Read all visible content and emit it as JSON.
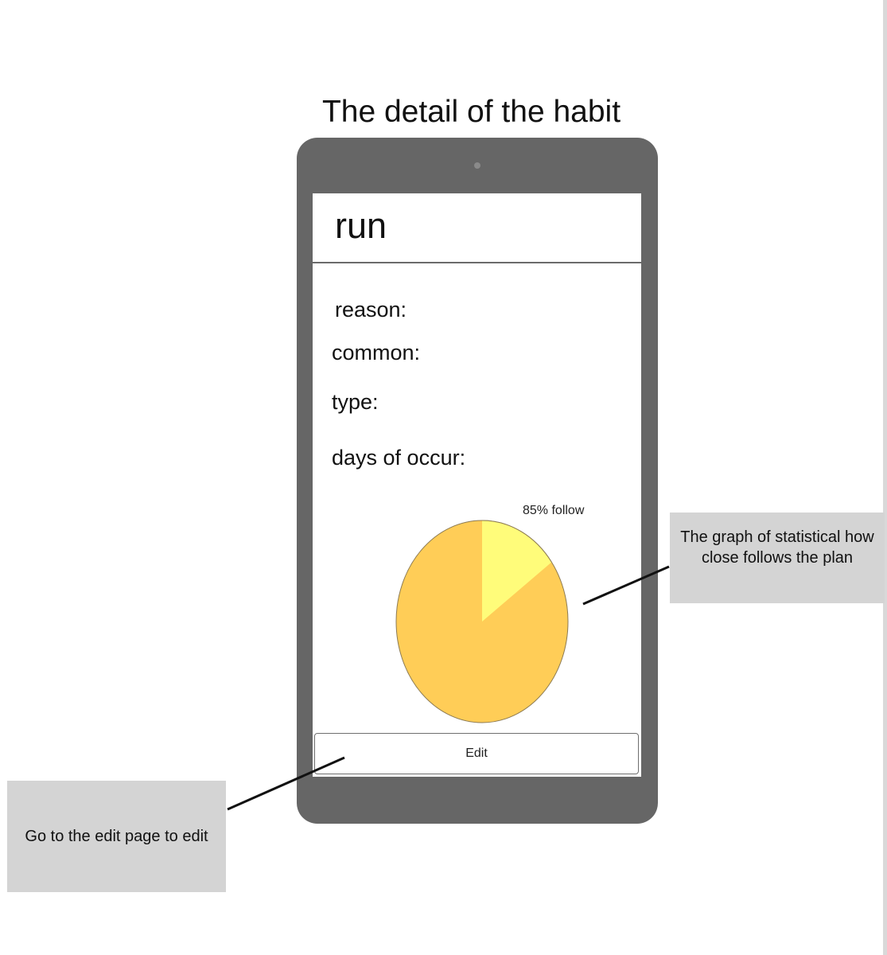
{
  "page": {
    "heading": "The detail of the habit"
  },
  "habit": {
    "name": "run",
    "fields": [
      {
        "label": "reason:"
      },
      {
        "label": "common:"
      },
      {
        "label": "type:"
      },
      {
        "label": "days of occur:"
      }
    ]
  },
  "chart_data": {
    "type": "pie",
    "title": "",
    "annotation": "85% follow",
    "slices": [
      {
        "label": "follow",
        "value": 85,
        "color": "#FFCD57"
      },
      {
        "label": "",
        "value": 15,
        "color": "#FFFC7A"
      }
    ]
  },
  "actions": {
    "edit_label": "Edit"
  },
  "annotations": {
    "graph_note": "The graph of statistical how close follows the plan",
    "edit_note": "Go to the edit page to edit"
  },
  "colors": {
    "device_frame": "#666666",
    "callout_bg": "#D4D4D4",
    "pie_main": "#FFCD57",
    "pie_small": "#FFFC7A"
  }
}
